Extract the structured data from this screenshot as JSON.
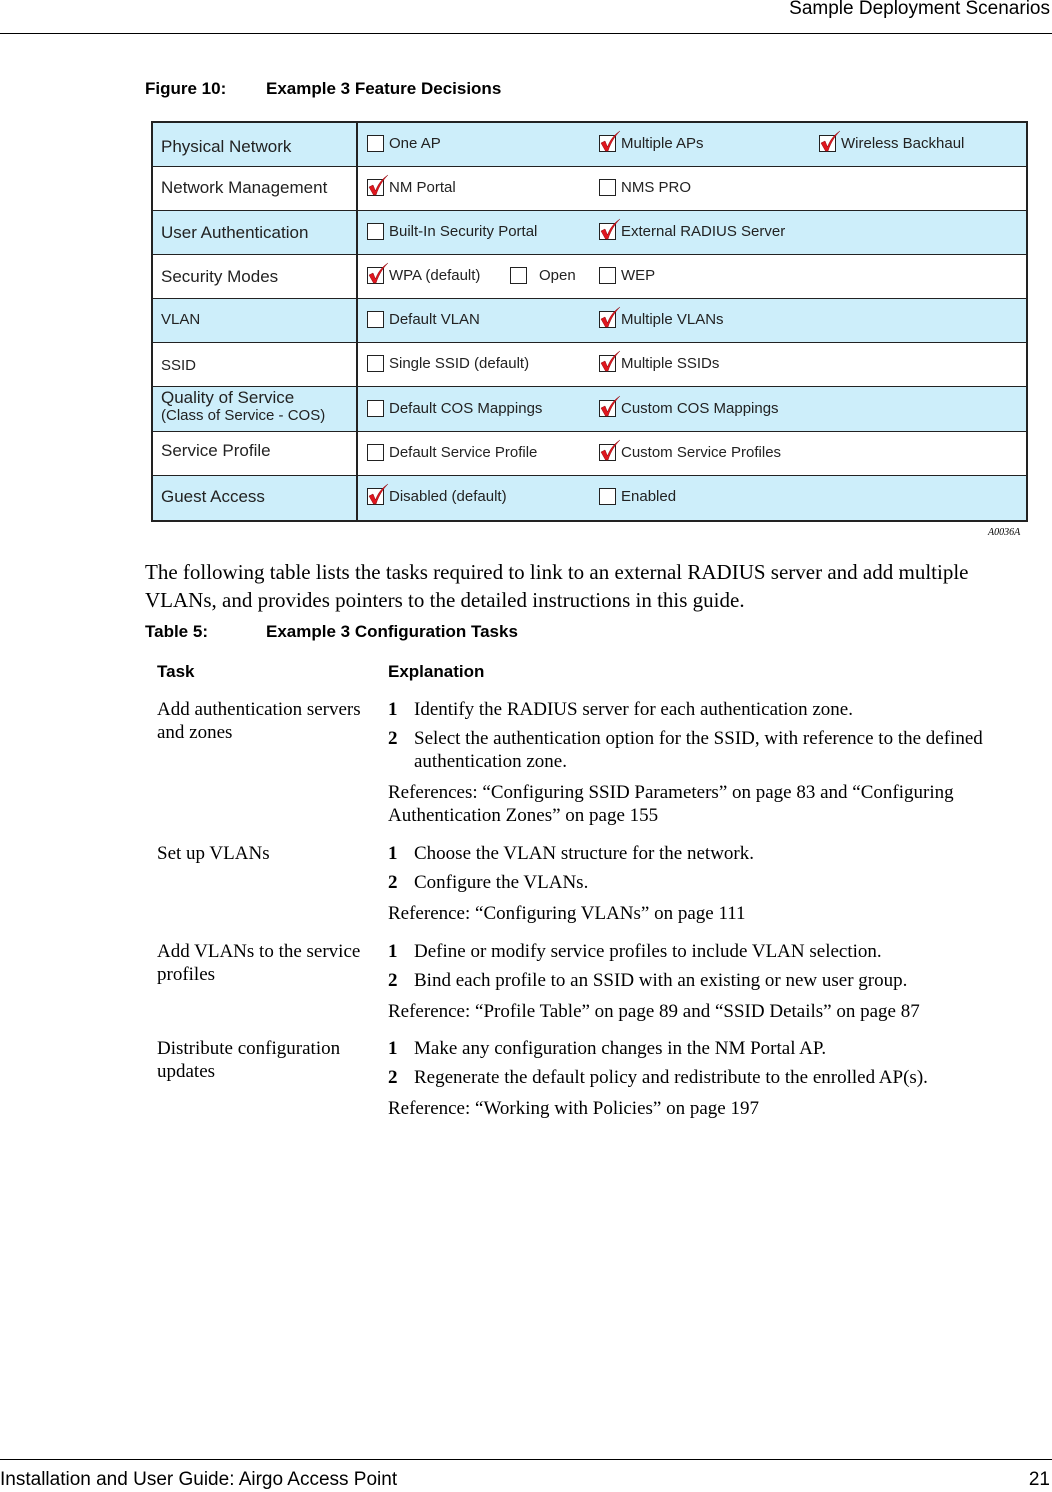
{
  "header": {
    "section_title": "Sample Deployment Scenarios"
  },
  "figure": {
    "label": "Figure 10:",
    "title": "Example 3 Feature Decisions",
    "id": "A0036A",
    "rows": [
      {
        "category": "Physical Network",
        "options": [
          {
            "label": "One AP",
            "checked": false
          },
          {
            "label": "Multiple APs",
            "checked": true
          },
          {
            "label": "Wireless Backhaul",
            "checked": true
          }
        ]
      },
      {
        "category": "Network Management",
        "options": [
          {
            "label": "NM Portal",
            "checked": true
          },
          {
            "label": "NMS PRO",
            "checked": false
          }
        ]
      },
      {
        "category": "User Authentication",
        "options": [
          {
            "label": "Built-In Security Portal",
            "checked": false
          },
          {
            "label": "External RADIUS Server",
            "checked": true
          }
        ]
      },
      {
        "category": "Security Modes",
        "options": [
          {
            "label": "WPA (default)",
            "checked": true
          },
          {
            "label": "Open",
            "checked": false
          },
          {
            "label": "WEP",
            "checked": false
          }
        ]
      },
      {
        "category": "VLAN",
        "options": [
          {
            "label": "Default VLAN",
            "checked": false
          },
          {
            "label": "Multiple VLANs",
            "checked": true
          }
        ]
      },
      {
        "category": "SSID",
        "options": [
          {
            "label": "Single SSID (default)",
            "checked": false
          },
          {
            "label": "Multiple SSIDs",
            "checked": true
          }
        ]
      },
      {
        "category": "Quality of Service",
        "subcategory": "(Class of Service - COS)",
        "options": [
          {
            "label": "Default COS Mappings",
            "checked": false
          },
          {
            "label": "Custom COS Mappings",
            "checked": true
          }
        ]
      },
      {
        "category": "Service Profile",
        "options": [
          {
            "label": "Default Service Profile",
            "checked": false
          },
          {
            "label": "Custom Service Profiles",
            "checked": true
          }
        ]
      },
      {
        "category": "Guest Access",
        "options": [
          {
            "label": "Disabled (default)",
            "checked": true
          },
          {
            "label": "Enabled",
            "checked": false
          }
        ]
      }
    ]
  },
  "intro_text": "The following table lists the tasks required to link to an external RADIUS server and add multiple VLANs, and provides pointers to the detailed instructions in this guide.",
  "table": {
    "label": "Table 5:",
    "title": "Example 3 Configuration Tasks",
    "headers": {
      "task": "Task",
      "explanation": "Explanation"
    },
    "rows": [
      {
        "task": "Add authentication servers and zones",
        "steps": [
          {
            "n": "1",
            "text": "Identify the RADIUS server for each authentication zone."
          },
          {
            "n": "2",
            "text": "Select the authentication option for the SSID, with reference to the defined authentication zone."
          }
        ],
        "reference": "References: “Configuring SSID Parameters” on page 83 and “Configuring Authentication Zones” on page 155"
      },
      {
        "task": "Set up VLANs",
        "steps": [
          {
            "n": "1",
            "text": "Choose the VLAN structure for the network."
          },
          {
            "n": "2",
            "text": "Configure the VLANs."
          }
        ],
        "reference": "Reference: “Configuring VLANs” on page 111"
      },
      {
        "task": "Add VLANs to the service profiles",
        "steps": [
          {
            "n": "1",
            "text": "Define or modify service profiles to include VLAN selection."
          },
          {
            "n": "2",
            "text": "Bind each profile to an SSID with an existing or new user group."
          }
        ],
        "reference": "Reference: “Profile Table” on page 89 and “SSID Details” on page 87"
      },
      {
        "task": "Distribute configuration updates",
        "steps": [
          {
            "n": "1",
            "text": "Make any configuration changes in the NM Portal AP."
          },
          {
            "n": "2",
            "text": "Regenerate the default policy and redistribute to the enrolled AP(s)."
          }
        ],
        "reference": "Reference: “Working with Policies” on page 197"
      }
    ]
  },
  "footer": {
    "guide_title": "Installation and User Guide: Airgo Access Point",
    "page_number": "21"
  },
  "colors": {
    "row_highlight": "#cdeefa",
    "check_mark": "#e0161e"
  }
}
